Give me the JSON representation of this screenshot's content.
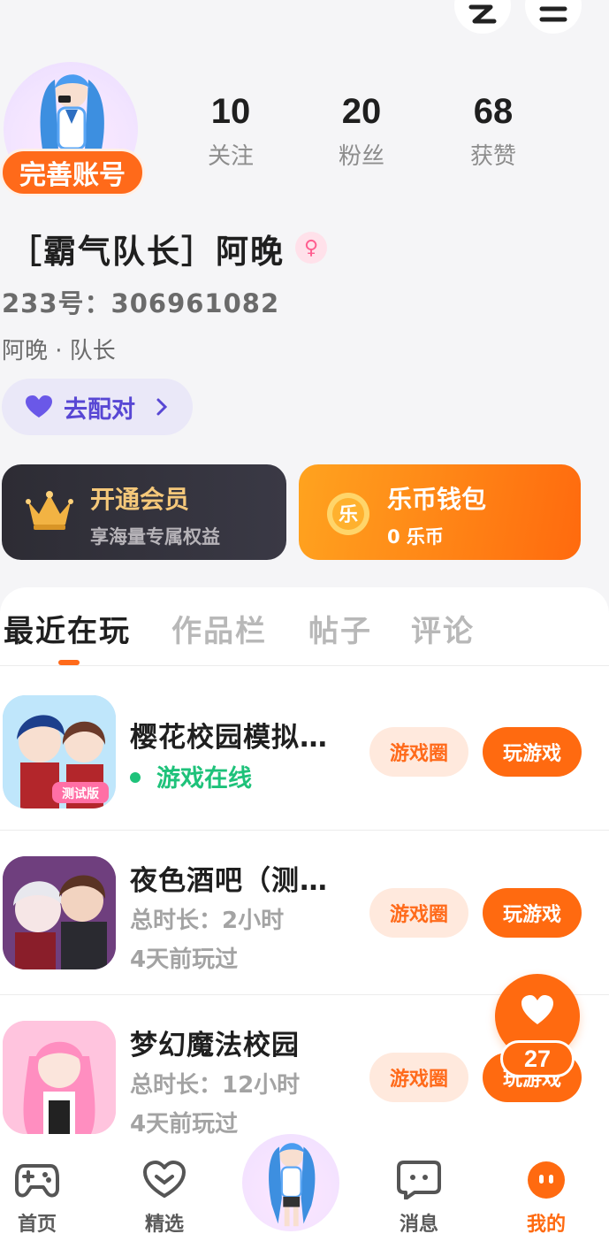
{
  "profile": {
    "complete_badge": "完善账号",
    "name": "［霸气队长］阿晚",
    "gender_icon": "♀",
    "id_line": "233号：306961082",
    "subline": "阿晚 · 队长",
    "match_label": "去配对"
  },
  "stats": [
    {
      "num": "10",
      "label": "关注"
    },
    {
      "num": "20",
      "label": "粉丝"
    },
    {
      "num": "68",
      "label": "获赞"
    }
  ],
  "cards": {
    "vip": {
      "title": "开通会员",
      "desc": "享海量专属权益"
    },
    "coin": {
      "title": "乐币钱包",
      "desc": "0 乐币",
      "icon_text": "乐"
    }
  },
  "tabs": [
    "最近在玩",
    "作品栏",
    "帖子",
    "评论"
  ],
  "games": [
    {
      "title": "樱花校园模拟…",
      "status": "游戏在线",
      "circle_btn": "游戏圈",
      "play_btn": "玩游戏"
    },
    {
      "title": "夜色酒吧（测…",
      "duration": "总时长：2小时",
      "last": "4天前玩过",
      "circle_btn": "游戏圈",
      "play_btn": "玩游戏"
    },
    {
      "title": "梦幻魔法校园",
      "duration": "总时长：12小时",
      "last": "4天前玩过",
      "circle_btn": "游戏圈",
      "play_btn": "玩游戏"
    }
  ],
  "game_badges": {
    "test_badge": "测试版"
  },
  "like_count": "27",
  "nav": [
    {
      "label": "首页"
    },
    {
      "label": "精选"
    },
    {
      "label": "消息"
    },
    {
      "label": "我的"
    }
  ],
  "colors": {
    "accent": "#ff6a10",
    "online": "#1ec27a",
    "match": "#5847d4"
  }
}
